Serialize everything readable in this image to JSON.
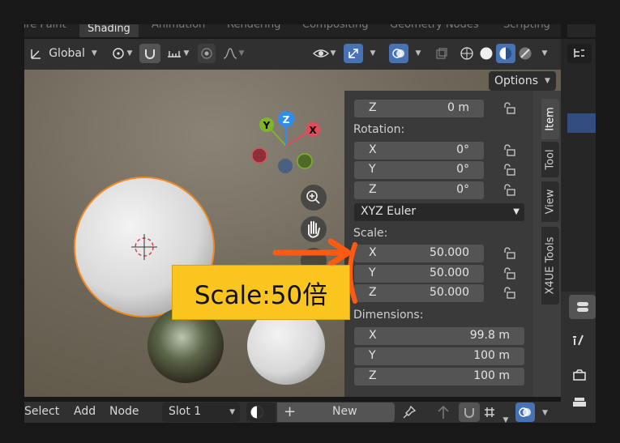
{
  "workspace_tabs": [
    "ure Paint",
    "Shading",
    "Animation",
    "Rendering",
    "Compositing",
    "Geometry Nodes",
    "Scripting"
  ],
  "active_workspace": "Shading",
  "header": {
    "orientation_label": "Global",
    "options_label": "Options"
  },
  "gizmo": {
    "x": "X",
    "y": "Y",
    "z": "Z"
  },
  "npanel": {
    "top_z": {
      "axis": "Z",
      "value": "0 m"
    },
    "rotation_label": "Rotation:",
    "rotation": [
      {
        "axis": "X",
        "value": "0°"
      },
      {
        "axis": "Y",
        "value": "0°"
      },
      {
        "axis": "Z",
        "value": "0°"
      }
    ],
    "rotation_mode": "XYZ Euler",
    "scale_label": "Scale:",
    "scale": [
      {
        "axis": "X",
        "value": "50.000"
      },
      {
        "axis": "Y",
        "value": "50.000"
      },
      {
        "axis": "Z",
        "value": "50.000"
      }
    ],
    "dimensions_label": "Dimensions:",
    "dimensions": [
      {
        "axis": "X",
        "value": "99.8 m"
      },
      {
        "axis": "Y",
        "value": "100 m"
      },
      {
        "axis": "Z",
        "value": "100 m"
      }
    ],
    "tabs": [
      "Item",
      "Tool",
      "View",
      "X4UE Tools"
    ],
    "active_tab": "Item"
  },
  "bottom_bar": {
    "menu": [
      "Select",
      "Add",
      "Node"
    ],
    "slot": "Slot 1",
    "new_label": "New"
  },
  "annotation": {
    "text": "Scale:50倍",
    "color": "#fbc51f",
    "arrow_color": "#ff5a14"
  },
  "colors": {
    "accent": "#4772b3",
    "selection": "#f08a24",
    "axis_x": "#e34a5a",
    "axis_y": "#7eb52a",
    "axis_z": "#2f8df0"
  }
}
